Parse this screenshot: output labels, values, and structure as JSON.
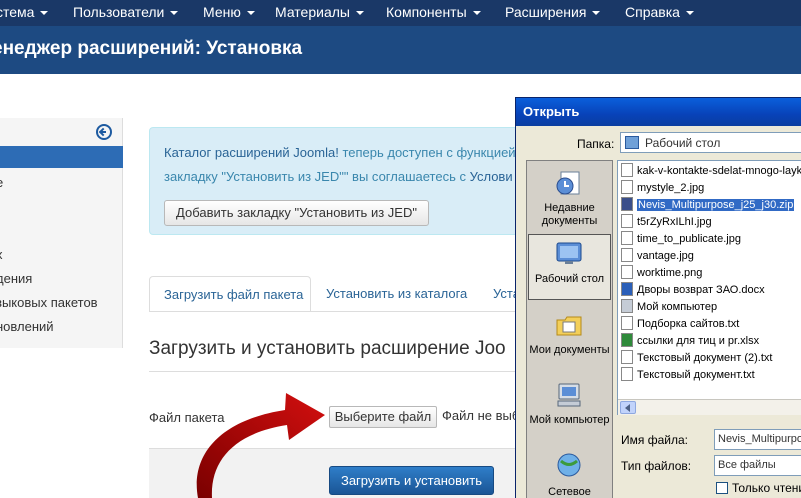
{
  "topnav": {
    "items": [
      "стема",
      "Пользователи",
      "Меню",
      "Материалы",
      "Компоненты",
      "Расширения",
      "Справка"
    ]
  },
  "page_title": "енеджер расширений: Установка",
  "sidebar": {
    "items": [
      "е",
      "х",
      "дения",
      "зыковых пакетов",
      "новлений"
    ]
  },
  "info": {
    "line1_link": "Каталог расширений Joomla!",
    "line1_text": " теперь доступен с функцией",
    "line2_text": "закладку \"Установить из JED\"\" вы соглашаетесь с ",
    "line2_link": "Услови",
    "button": "Добавить закладку \"Установить из JED\""
  },
  "tabs": [
    "Загрузить файл пакета",
    "Установить из каталога",
    "Устан"
  ],
  "section_title": "Загрузить и установить расширение Joo",
  "form": {
    "package_label": "Файл пакета",
    "choose_button": "Выберите файл",
    "no_file": "Файл не выб",
    "submit": "Загрузить и установить"
  },
  "dialog": {
    "title": "Открыть",
    "folder_label": "Папка:",
    "folder_value": "Рабочий стол",
    "places": [
      "Недавние документы",
      "Рабочий стол",
      "Мои документы",
      "Мой компьютер",
      "Сетевое"
    ],
    "files": [
      "kak-v-kontakte-sdelat-mnogo-layk",
      "mystyle_2.jpg",
      "Nevis_Multipurpose_j25_j30.zip",
      "t5rZyRxILhI.jpg",
      "time_to_publicate.jpg",
      "vantage.jpg",
      "worktime.png",
      "Дворы возврат ЗАО.docx",
      "Мой компьютер",
      "Подборка сайтов.txt",
      "ссылки для тиц и pr.xlsx",
      "Текстовый документ (2).txt",
      "Текстовый документ.txt"
    ],
    "filename_label": "Имя файла:",
    "filename_value": "Nevis_Multipurpo",
    "filetype_label": "Тип файлов:",
    "filetype_value": "Все файлы",
    "readonly_label": "Только чтени"
  }
}
